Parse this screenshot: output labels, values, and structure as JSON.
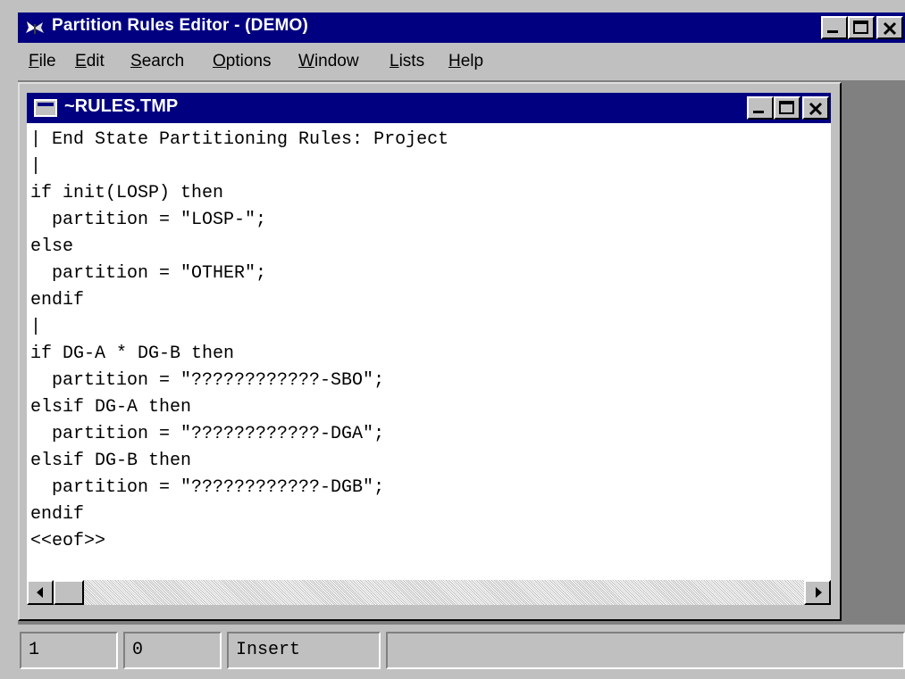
{
  "app": {
    "title": "Partition Rules Editor - (DEMO)",
    "icon": "butterfly-app-icon",
    "controls": {
      "minimize": "minimize-icon",
      "maximize": "maximize-icon",
      "close": "close-icon"
    }
  },
  "menu": {
    "items": [
      {
        "key": "F",
        "rest": "ile"
      },
      {
        "key": "E",
        "rest": "dit"
      },
      {
        "key": "S",
        "rest": "earch"
      },
      {
        "key": "O",
        "rest": "ptions"
      },
      {
        "key": "W",
        "rest": "indow"
      },
      {
        "key": "L",
        "rest": "ists"
      },
      {
        "key": "H",
        "rest": "elp"
      }
    ]
  },
  "document": {
    "title": "~RULES.TMP",
    "lines": [
      "| End State Partitioning Rules: Project",
      "|",
      "if init(LOSP) then",
      "  partition = \"LOSP-\";",
      "else",
      "  partition = \"OTHER\";",
      "endif",
      "|",
      "if DG-A * DG-B then",
      "  partition = \"????????????-SBO\";",
      "elsif DG-A then",
      "  partition = \"????????????-DGA\";",
      "elsif DG-B then",
      "  partition = \"????????????-DGB\";",
      "endif",
      "<<eof>>"
    ]
  },
  "status": {
    "line": "1",
    "column": "0",
    "mode": "Insert",
    "message": ""
  },
  "colors": {
    "titlebar": "#000080",
    "face": "#c0c0c0",
    "mdi_background": "#808080"
  }
}
